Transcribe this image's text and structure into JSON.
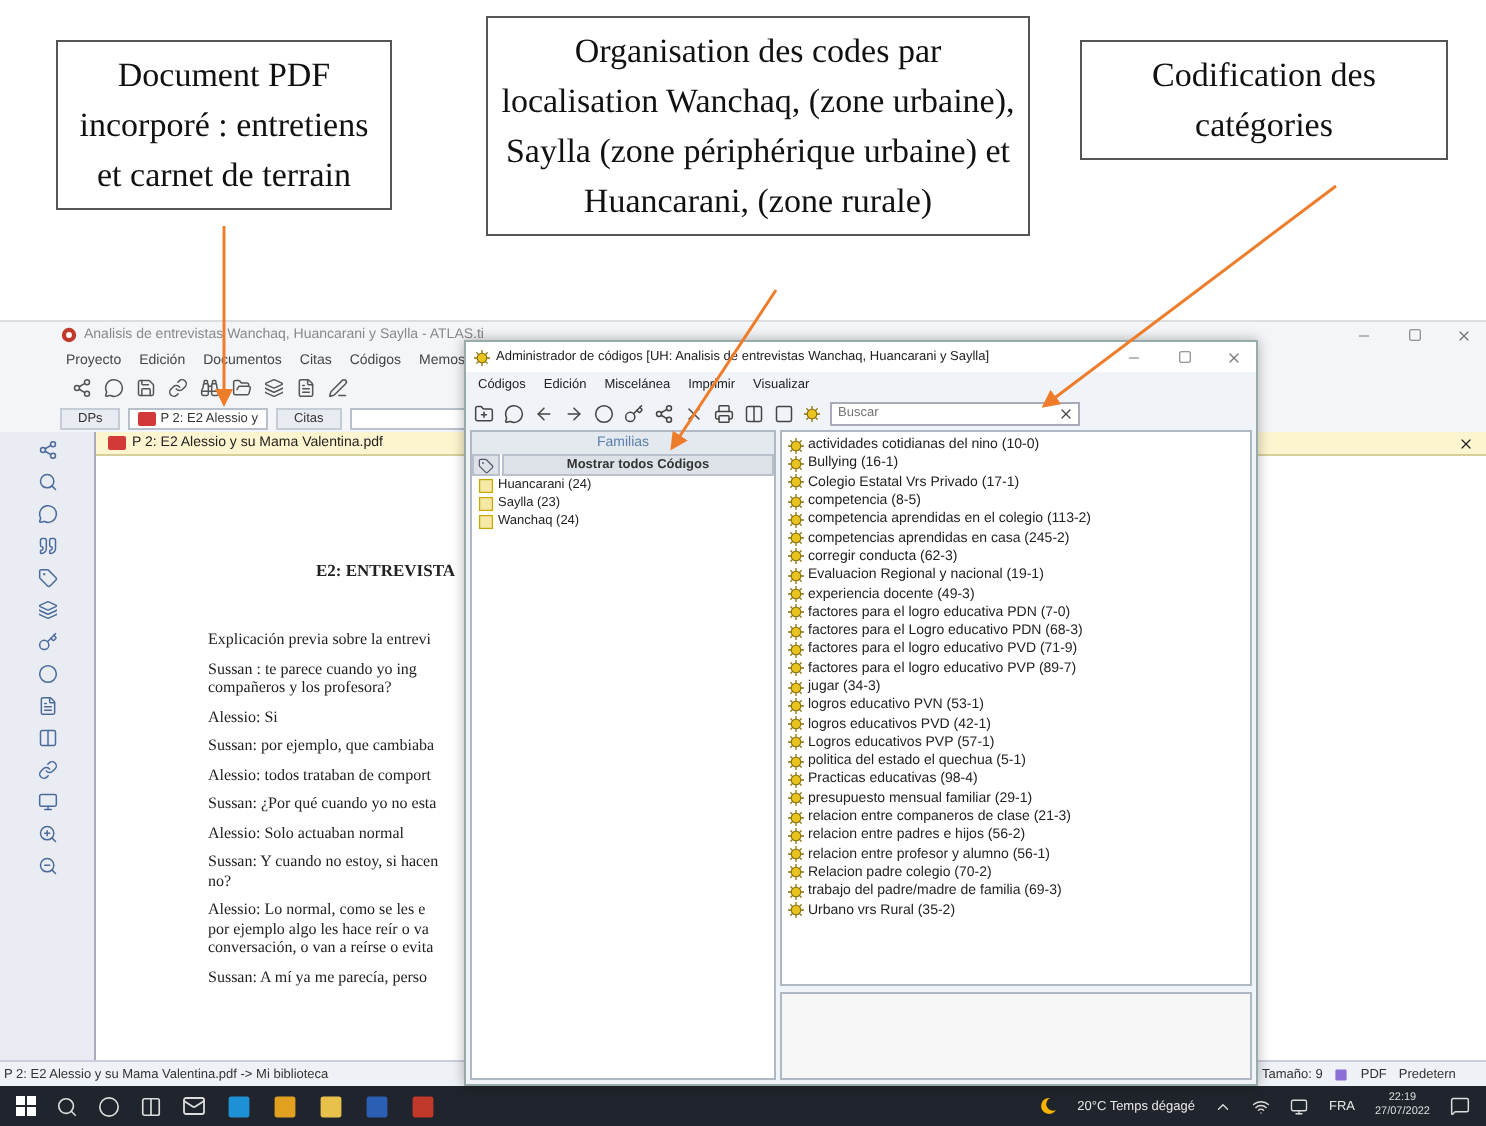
{
  "annotations": [
    {
      "text": "Document PDF incorporé : entretiens et carnet de terrain"
    },
    {
      "text": "Organisation des codes par localisation Wanchaq, (zone urbaine), Saylla (zone périphérique urbaine) et Huancarani, (zone rurale)"
    },
    {
      "text": "Codification des catégories"
    }
  ],
  "main_window": {
    "title": "Analisis de entrevistas Wanchaq, Huancarani y Saylla - ATLAS.ti",
    "menu": [
      "Proyecto",
      "Edición",
      "Documentos",
      "Citas",
      "Códigos",
      "Memos"
    ],
    "documents_button": "DPs",
    "document_selector": "P 2: E2 Alessio y",
    "quotes_button": "Citas",
    "document": {
      "tab_title": "P 2: E2 Alessio y su Mama Valentina.pdf",
      "heading": "E2: ENTREVISTA",
      "paragraphs": [
        [
          "Explicación previa sobre la entrevi"
        ],
        [
          "Sussan : te parece cuando yo ing",
          "compañeros y los profesora?"
        ],
        [
          "Alessio: Si"
        ],
        [
          "Sussan: por ejemplo, que cambiaba"
        ],
        [
          "Alessio: todos trataban de comport"
        ],
        [
          "Sussan: ¿Por qué cuando yo no esta"
        ],
        [
          "Alessio: Solo actuaban normal"
        ],
        [
          "Sussan: Y cuando no estoy, si hacen",
          "no?"
        ],
        [
          "Alessio: Lo normal, como se les e",
          "por ejemplo algo les hace reír o va",
          "conversación, o van a reírse o evita"
        ],
        [
          "Sussan: A mí ya me parecía, perso"
        ]
      ]
    },
    "status_bar": {
      "path": "P 2: E2 Alessio y su Mama Valentina.pdf -> Mi biblioteca",
      "size": "Tamaño: 9",
      "format": "PDF",
      "mode": "Predetern"
    }
  },
  "code_manager": {
    "title": "Administrador de códigos [UH: Analisis de entrevistas Wanchaq, Huancarani y Saylla]",
    "menu": [
      "Códigos",
      "Edición",
      "Miscelánea",
      "Imprimir",
      "Visualizar"
    ],
    "search": {
      "placeholder": "Buscar"
    },
    "families_header": "Familias",
    "show_all_button": "Mostrar todos Códigos",
    "families": [
      "Huancarani (24)",
      "Saylla (23)",
      "Wanchaq (24)"
    ],
    "codes": [
      "actividades cotidianas del nino (10-0)",
      "Bullying (16-1)",
      "Colegio Estatal Vrs Privado (17-1)",
      "competencia (8-5)",
      "competencia aprendidas en el colegio (113-2)",
      "competencias aprendidas en casa (245-2)",
      "corregir conducta (62-3)",
      "Evaluacion Regional y nacional (19-1)",
      "experiencia docente (49-3)",
      "factores para el logro educativa PDN (7-0)",
      "factores para el Logro educativo PDN (68-3)",
      "factores para el logro educativo PVD (71-9)",
      "factores para el logro educativo PVP (89-7)",
      "jugar (34-3)",
      "logros educativo PVN (53-1)",
      "logros educativos PVD (42-1)",
      "Logros educativos PVP (57-1)",
      "politica del estado el quechua (5-1)",
      "Practicas educativas (98-4)",
      "presupuesto mensual familiar (29-1)",
      "relacion entre companeros de clase (21-3)",
      "relacion entre padres e hijos (56-2)",
      "relacion entre profesor y alumno (56-1)",
      "Relacion padre colegio (70-2)",
      "trabajo del padre/madre de familia (69-3)",
      "Urbano vrs Rural (35-2)"
    ]
  },
  "taskbar": {
    "weather": "20°C Temps dégagé",
    "language": "FRA",
    "time": "22:19",
    "date": "27/07/2022"
  }
}
